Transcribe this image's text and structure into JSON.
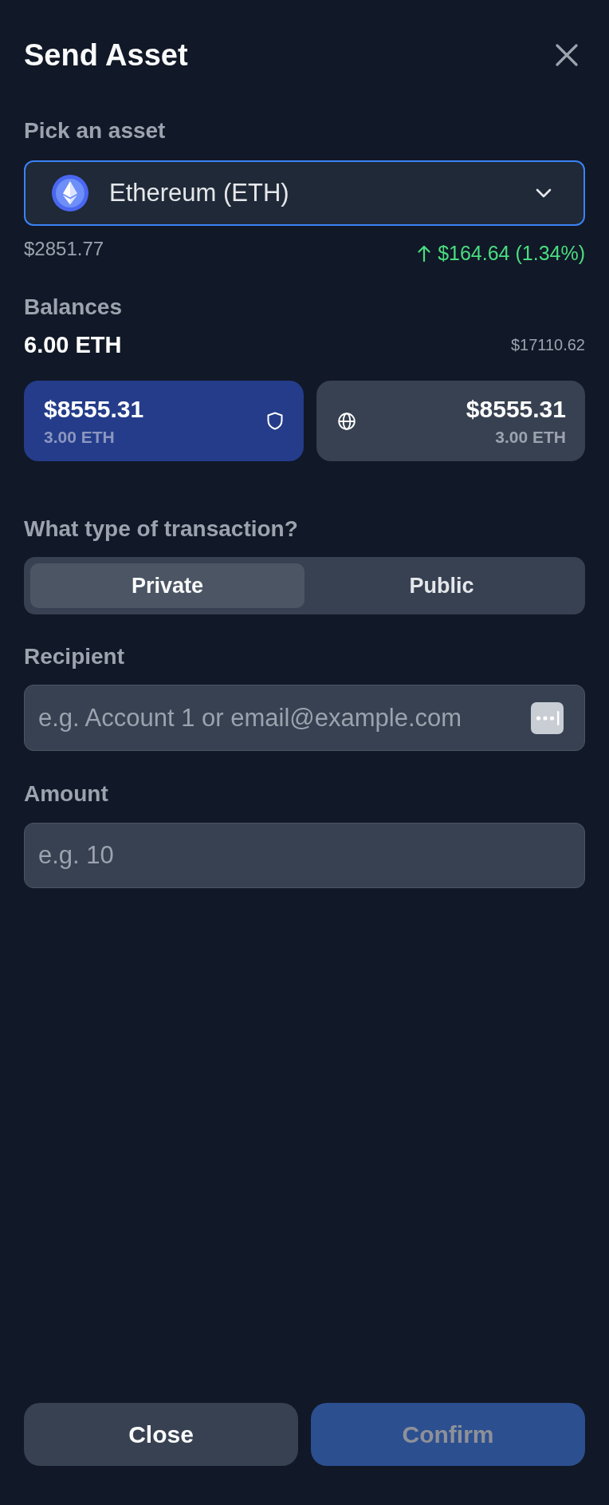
{
  "header": {
    "title": "Send Asset"
  },
  "asset_picker": {
    "label": "Pick an asset",
    "selected_asset": "Ethereum (ETH)",
    "price": "$2851.77",
    "change": "$164.64 (1.34%)",
    "change_positive": true
  },
  "balances": {
    "label": "Balances",
    "total": "6.00 ETH",
    "total_usd": "$17110.62",
    "accounts": [
      {
        "kind": "private",
        "usd": "$8555.31",
        "amount": "3.00 ETH",
        "selected": true
      },
      {
        "kind": "public",
        "usd": "$8555.31",
        "amount": "3.00 ETH",
        "selected": false
      }
    ]
  },
  "transaction_type": {
    "label": "What type of transaction?",
    "options": [
      {
        "label": "Private",
        "selected": true
      },
      {
        "label": "Public",
        "selected": false
      }
    ]
  },
  "recipient": {
    "label": "Recipient",
    "placeholder": "e.g. Account 1 or email@example.com"
  },
  "amount": {
    "label": "Amount",
    "placeholder": "e.g. 10"
  },
  "buttons": [
    {
      "label": "Close",
      "kind": "secondary",
      "disabled": false
    },
    {
      "label": "Confirm",
      "kind": "primary",
      "disabled": true
    }
  ]
}
